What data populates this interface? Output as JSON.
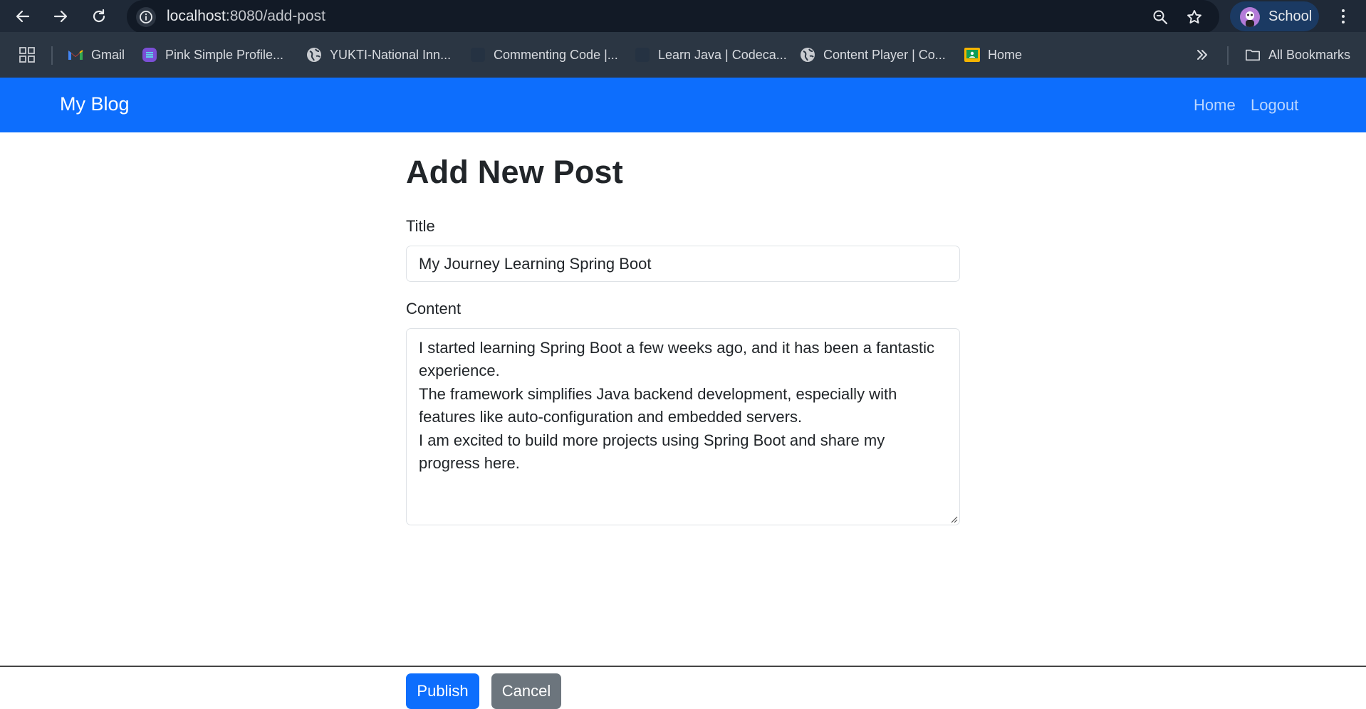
{
  "browser": {
    "url_host": "localhost",
    "url_path": ":8080/add-post",
    "profile_label": "School",
    "icons": {
      "back": "arrow-left-icon",
      "forward": "arrow-right-icon",
      "reload": "reload-icon",
      "site_info": "info-icon",
      "zoom": "zoom-icon",
      "bookmark_star": "star-icon",
      "menu": "more-vertical-icon"
    }
  },
  "bookmarks": {
    "items": [
      {
        "label": "Gmail",
        "icon": "gmail-icon"
      },
      {
        "label": "Pink Simple Profile...",
        "icon": "canva-icon"
      },
      {
        "label": "YUKTI-National Inn...",
        "icon": "globe-icon"
      },
      {
        "label": "Commenting Code |...",
        "icon": "codecademy-icon"
      },
      {
        "label": "Learn Java | Codeca...",
        "icon": "codecademy-icon"
      },
      {
        "label": "Content Player | Co...",
        "icon": "globe-icon"
      },
      {
        "label": "Home",
        "icon": "classroom-icon"
      }
    ],
    "overflow_icon": "double-chevron-right-icon",
    "all_bookmarks_label": "All Bookmarks"
  },
  "navbar": {
    "brand": "My Blog",
    "links": [
      "Home",
      "Logout"
    ],
    "color": "#0d6efd"
  },
  "form": {
    "heading": "Add New Post",
    "title_label": "Title",
    "title_value": "My Journey Learning Spring Boot",
    "content_label": "Content",
    "content_lines": [
      "I started learning Spring Boot a few weeks ago, and it has been a fantastic experience.",
      "The framework simplifies Java backend development, especially with features like auto-configuration and embedded servers.",
      "I am excited to build more projects using Spring Boot and share my progress here."
    ],
    "publish_label": "Publish",
    "cancel_label": "Cancel"
  }
}
